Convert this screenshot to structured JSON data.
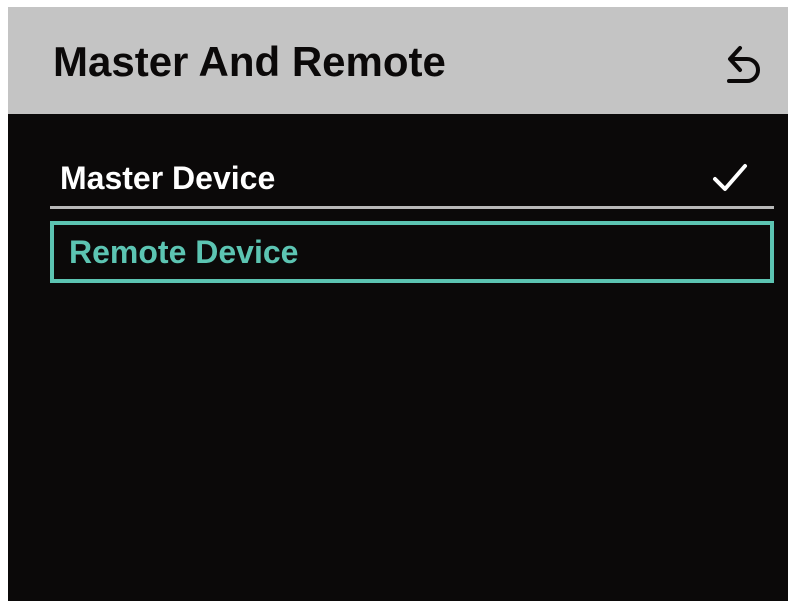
{
  "header": {
    "title": "Master And Remote",
    "back_icon": "back-arrow-icon"
  },
  "menu": {
    "items": [
      {
        "label": "Master Device",
        "checked": true,
        "focused": false,
        "icon": "checkmark-icon"
      },
      {
        "label": "Remote Device",
        "checked": false,
        "focused": true
      }
    ]
  },
  "colors": {
    "background": "#0b0909",
    "header_background": "#c4c4c4",
    "header_text": "#0b0909",
    "item_text": "#ffffff",
    "focus_accent": "#5cc4b2",
    "divider": "#b8b8b8"
  }
}
